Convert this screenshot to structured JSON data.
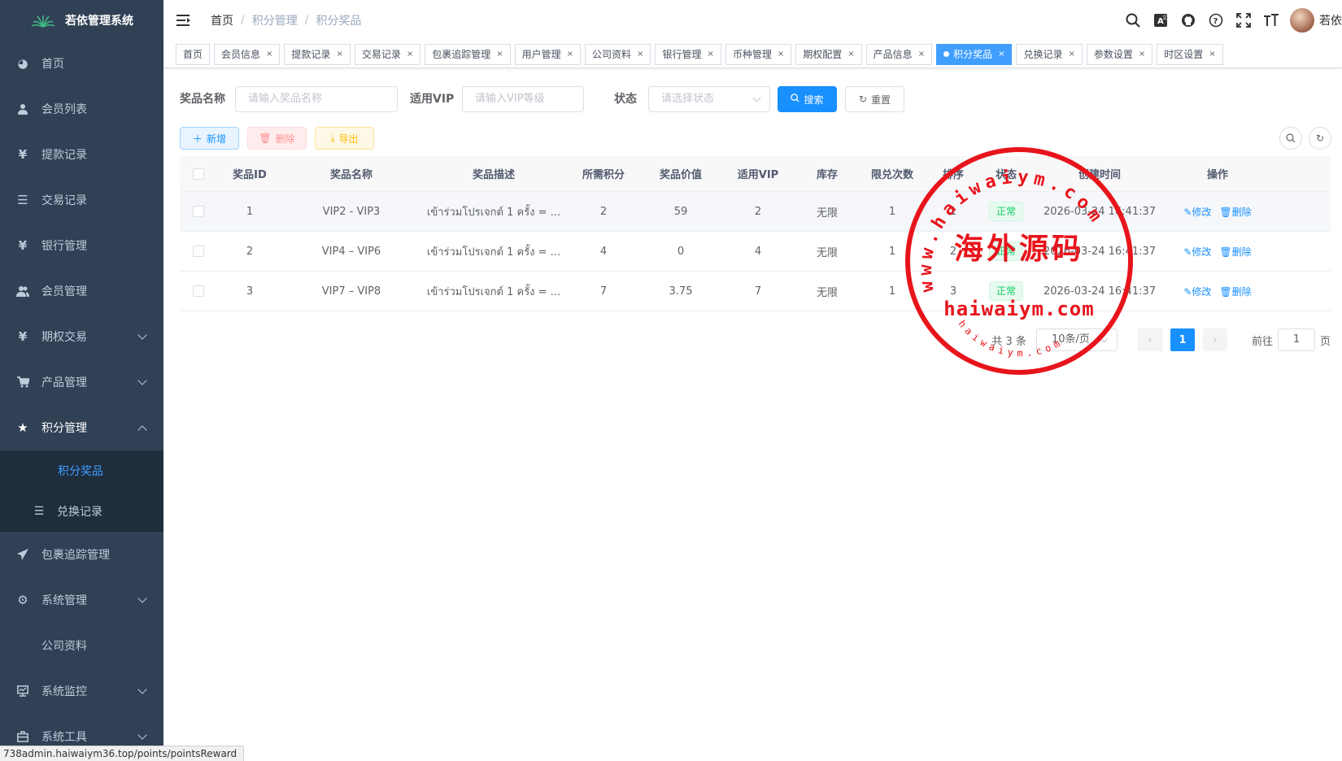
{
  "app": {
    "title": "若依管理系统"
  },
  "sidebar": {
    "items": [
      {
        "label": "首页",
        "icon": "dashboard-icon"
      },
      {
        "label": "会员列表",
        "icon": "user-icon"
      },
      {
        "label": "提款记录",
        "icon": "yen-icon"
      },
      {
        "label": "交易记录",
        "icon": "list-icon"
      },
      {
        "label": "银行管理",
        "icon": "yen-icon"
      },
      {
        "label": "会员管理",
        "icon": "peoples-icon"
      },
      {
        "label": "期权交易",
        "icon": "yen-icon"
      },
      {
        "label": "产品管理",
        "icon": "cart-icon"
      },
      {
        "label": "积分管理",
        "icon": "star-icon"
      }
    ],
    "points_sub": [
      {
        "label": "积分奖品"
      },
      {
        "label": "兑换记录"
      }
    ],
    "items_after": [
      {
        "label": "包裹追踪管理",
        "icon": "send-icon"
      },
      {
        "label": "系统管理",
        "icon": "gear-icon"
      },
      {
        "label": "公司资料"
      },
      {
        "label": "系统监控",
        "icon": "monitor-icon"
      },
      {
        "label": "系统工具",
        "icon": "toolbox-icon"
      }
    ]
  },
  "navbar": {
    "breadcrumb": [
      "首页",
      "积分管理",
      "积分奖品"
    ],
    "username": "若依"
  },
  "tags": [
    {
      "label": "首页",
      "closable": false
    },
    {
      "label": "会员信息"
    },
    {
      "label": "提款记录"
    },
    {
      "label": "交易记录"
    },
    {
      "label": "包裹追踪管理"
    },
    {
      "label": "用户管理"
    },
    {
      "label": "公司资料"
    },
    {
      "label": "银行管理"
    },
    {
      "label": "币种管理"
    },
    {
      "label": "期权配置"
    },
    {
      "label": "产品信息"
    },
    {
      "label": "积分奖品",
      "active": true
    },
    {
      "label": "兑换记录"
    },
    {
      "label": "参数设置"
    },
    {
      "label": "时区设置"
    }
  ],
  "search": {
    "name_label": "奖品名称",
    "name_placeholder": "请输入奖品名称",
    "vip_label": "适用VIP",
    "vip_placeholder": "请输入VIP等级",
    "status_label": "状态",
    "status_placeholder": "请选择状态",
    "search_btn": "搜索",
    "reset_btn": "重置"
  },
  "toolbar": {
    "add": "新增",
    "delete": "删除",
    "export": "导出"
  },
  "table": {
    "columns": [
      "奖品ID",
      "奖品名称",
      "奖品描述",
      "所需积分",
      "奖品价值",
      "适用VIP",
      "库存",
      "限兑次数",
      "排序",
      "状态",
      "创建时间",
      "操作"
    ],
    "rows": [
      {
        "id": "1",
        "name": "VIP2 - VIP3",
        "desc": "เข้าร่วมโปรเจกต์ 1 ครั้ง = ...",
        "points": "2",
        "value": "59",
        "vip": "2",
        "stock": "无限",
        "limit": "1",
        "sort": "1",
        "status": "正常",
        "created": "2026-03-24 16:41:37"
      },
      {
        "id": "2",
        "name": "VIP4 – VIP6",
        "desc": "เข้าร่วมโปรเจกต์ 1 ครั้ง = ...",
        "points": "4",
        "value": "0",
        "vip": "4",
        "stock": "无限",
        "limit": "1",
        "sort": "2",
        "status": "正常",
        "created": "2026-03-24 16:41:37"
      },
      {
        "id": "3",
        "name": "VIP7 – VIP8",
        "desc": "เข้าร่วมโปรเจกต์ 1 ครั้ง = ...",
        "points": "7",
        "value": "3.75",
        "vip": "7",
        "stock": "无限",
        "limit": "1",
        "sort": "3",
        "status": "正常",
        "created": "2026-03-24 16:41:37"
      }
    ],
    "edit_label": "修改",
    "delete_label": "删除"
  },
  "pagination": {
    "total": "共 3 条",
    "page_size": "10条/页",
    "current": "1",
    "goto_label": "前往",
    "goto_value": "1",
    "page_unit": "页"
  },
  "statusbar": {
    "url": "738admin.haiwaiym36.top/points/pointsReward"
  },
  "watermark": {
    "top_text": "www.haiwaiym.com",
    "center_text": "海外源码",
    "domain": "haiwaiym.com",
    "bottom_text": "haiwaiym.com"
  },
  "colors": {
    "sidebar_bg": "#304156",
    "submenu_bg": "#1f2d3d",
    "primary": "#1890ff",
    "active_menu": "#409eff",
    "success": "#13ce66",
    "stamp_red": "#e8141c"
  }
}
